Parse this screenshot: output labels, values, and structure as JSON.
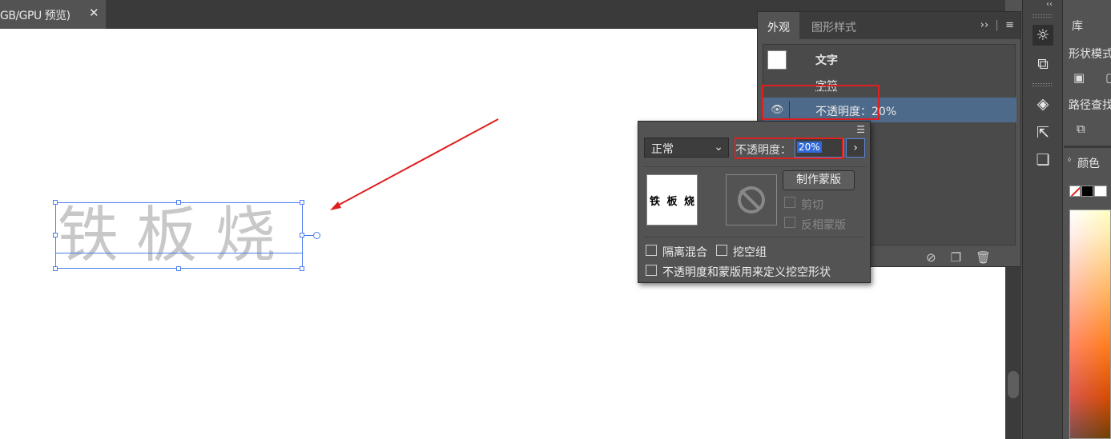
{
  "document_tab": {
    "title": "GB/GPU 预览)",
    "close_glyph": "✕"
  },
  "artwork": {
    "text": "铁板烧"
  },
  "appearance_panel": {
    "tab_active": "外观",
    "tab_other": "图形样式",
    "expand_glyph": "››",
    "menu_glyph": "≡",
    "rows": [
      {
        "label": "文字"
      },
      {
        "label": "字符"
      },
      {
        "label": "不透明度：20%"
      }
    ],
    "footer": {
      "clear_icon": "clear-appearance-icon",
      "duplicate_icon": "duplicate-item-icon",
      "delete_icon": "trash-icon"
    }
  },
  "transparency_panel": {
    "menu_glyph": "☰",
    "blend_mode": "正常",
    "opacity_label": "不透明度：",
    "opacity_value": "20%",
    "opacity_button": "›",
    "thumb_text": "铁 板 烧",
    "make_mask_label": "制作蒙版",
    "clip_label": "剪切",
    "invert_mask_label": "反相蒙版",
    "isolate_blend_label": "隔离混合",
    "knockout_group_label": "挖空组",
    "opacity_mask_knockout_label": "不透明度和蒙版用来定义挖空形状"
  },
  "right_panel": {
    "library_tab": "库",
    "shape_modes_label": "形状模式",
    "pathfinder_label": "路径查找",
    "color_label": "颜色",
    "color_chevron": "⬨"
  },
  "colors": {
    "selection_blue": "#4a7cf0",
    "annotation_red": "#e02020",
    "highlight_row": "#4e6a8a"
  }
}
